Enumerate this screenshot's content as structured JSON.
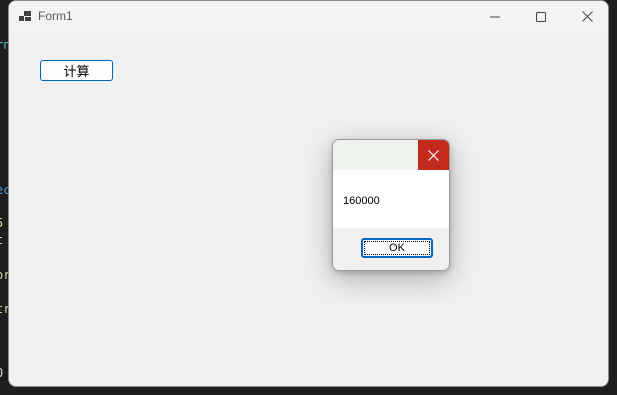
{
  "editor_fragments": [
    "rn",
    "ec",
    "5",
    "t",
    "or",
    "tr",
    "0"
  ],
  "window": {
    "title": "Form1",
    "icon": "app-form-icon",
    "controls": {
      "minimize_icon": "minimize-icon",
      "maximize_icon": "maximize-icon",
      "close_icon": "close-icon"
    }
  },
  "form": {
    "calc_button_label": "计算"
  },
  "message_box": {
    "title": "",
    "text": "160000",
    "ok_label": "OK",
    "close_icon": "close-icon"
  },
  "colors": {
    "accent": "#0067c0",
    "close_red": "#c42b1c",
    "window_bg": "#f0f0f0"
  }
}
